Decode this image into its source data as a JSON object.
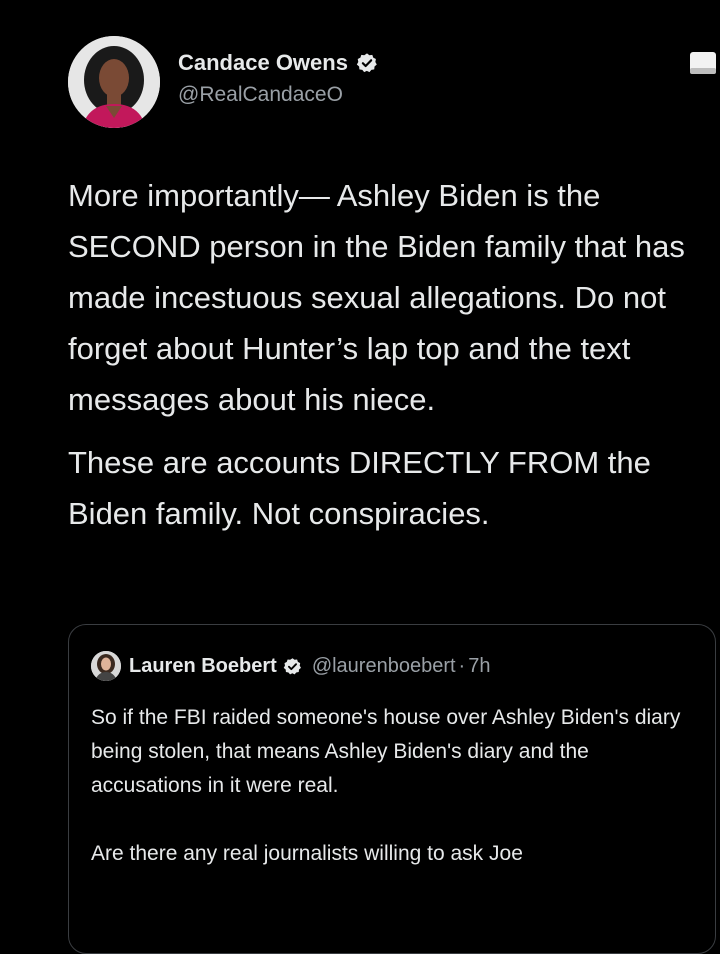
{
  "author": {
    "display_name": "Candace Owens",
    "handle": "@RealCandaceO",
    "verified_icon": "verified-badge-icon",
    "avatar_icon": "profile-avatar"
  },
  "tweet": {
    "paragraphs": [
      "More importantly— Ashley Biden is the SECOND person in the Biden family that has made incestuous sexual allegations. Do not forget about Hunter’s lap top and the text messages about his niece.",
      "These are accounts DIRECTLY FROM the Biden family. Not conspiracies."
    ]
  },
  "quoted_tweet": {
    "display_name": "Lauren Boebert",
    "handle": "@laurenboebert",
    "separator": "·",
    "time": "7h",
    "paragraphs": [
      "So if the FBI raided someone's house over Ashley Biden's diary being stolen, that means Ashley Biden's diary and the accusations in it were real.",
      "Are there any real journalists willing to ask Joe"
    ]
  },
  "colors": {
    "background": "#000000",
    "text": "#e7e9ea",
    "muted": "#9aa0a6",
    "border": "#3a3d41"
  }
}
